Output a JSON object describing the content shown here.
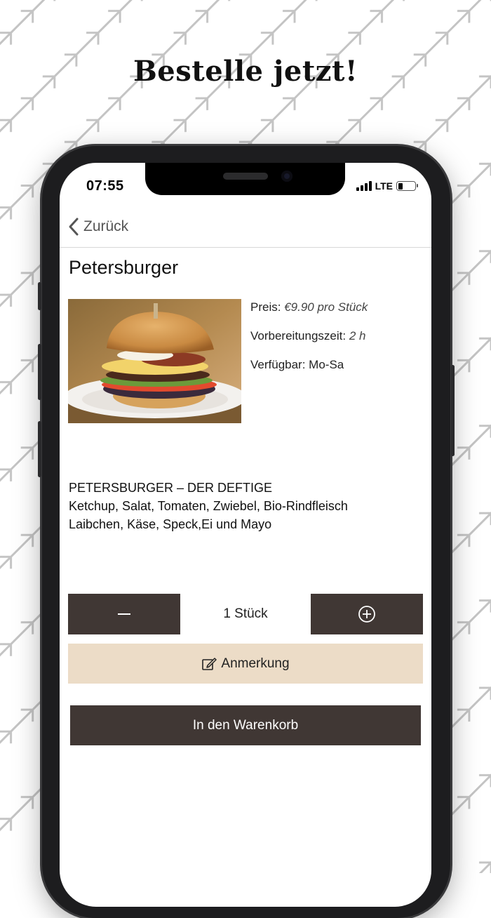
{
  "headline": "Bestelle jetzt!",
  "status_bar": {
    "time": "07:55",
    "network": "LTE"
  },
  "nav": {
    "back_label": "Zurück"
  },
  "product": {
    "name": "Petersburger",
    "price_label": "Preis:",
    "price_value": "€9.90 pro Stück",
    "prep_label": "Vorbereitungszeit:",
    "prep_value": "2 h",
    "availability": "Verfügbar: Mo-Sa",
    "description_lines": [
      "PETERSBURGER – DER DEFTIGE",
      "Ketchup, Salat, Tomaten, Zwiebel, Bio-Rindfleisch",
      "Laibchen, Käse, Speck,Ei  und Mayo"
    ]
  },
  "quantity": {
    "label": "1 Stück"
  },
  "buttons": {
    "note_label": "Anmerkung",
    "cart_label": "In den Warenkorb"
  },
  "colors": {
    "dark_button": "#403734",
    "note_button": "#ecdcc7",
    "pattern": "#bdbdbd"
  },
  "icons": [
    "chevron-left-icon",
    "minus-icon",
    "plus-circle-icon",
    "edit-note-icon",
    "signal-icon",
    "battery-icon"
  ]
}
